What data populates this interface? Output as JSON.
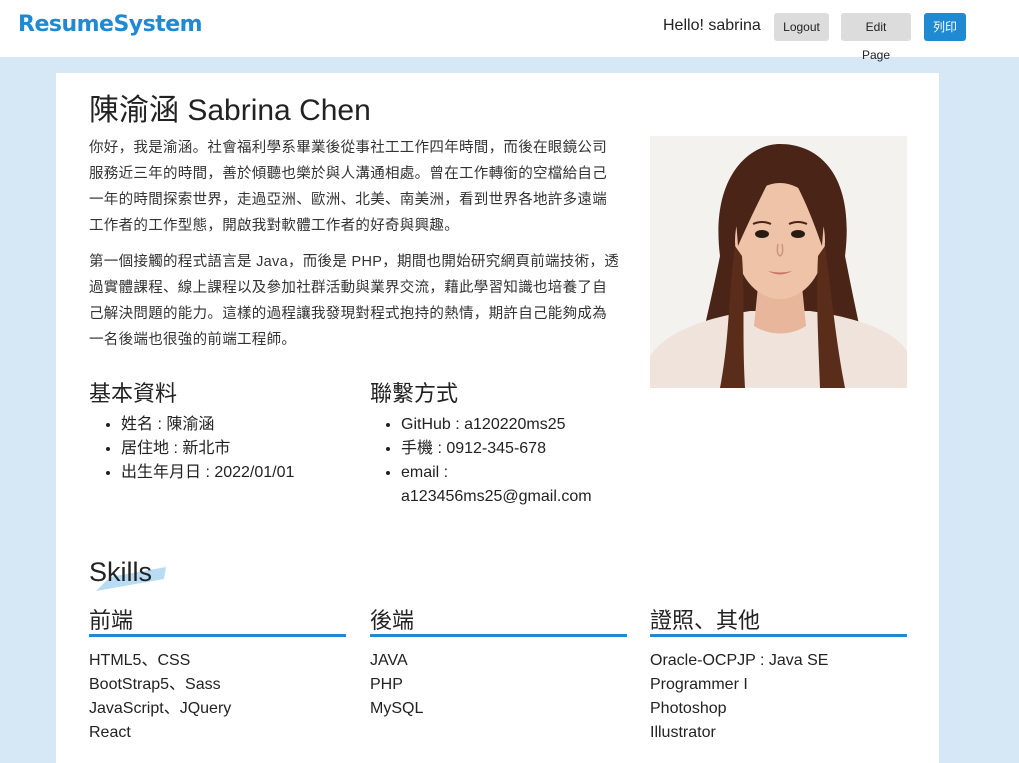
{
  "header": {
    "brand": "ResumeSystem",
    "greeting": "Hello! sabrina",
    "logout_label": "Logout",
    "edit_label": "Edit Page",
    "print_label": "列印"
  },
  "profile": {
    "name": "陳渝涵 Sabrina Chen",
    "intro": [
      "你好，我是渝涵。社會福利學系畢業後從事社工工作四年時間，而後在眼鏡公司服務近三年的時間，善於傾聽也樂於與人溝通相處。曾在工作轉銜的空檔給自己一年的時間探索世界，走過亞洲、歐洲、北美、南美洲，看到世界各地許多遠端工作者的工作型態，開啟我對軟體工作者的好奇與興趣。",
      "第一個接觸的程式語言是 Java，而後是 PHP，期間也開始研究網頁前端技術，透過實體課程、線上課程以及參加社群活動與業界交流，藉此學習知識也培養了自己解決問題的能力。這樣的過程讓我發現對程式抱持的熱情，期許自己能夠成為一名後端也很強的前端工程師。"
    ]
  },
  "basic": {
    "title": "基本資料",
    "items": [
      "姓名 : 陳渝涵",
      "居住地 : 新北市",
      "出生年月日 : 2022/01/01"
    ]
  },
  "contact": {
    "title": "聯繫方式",
    "items": [
      "GitHub : a120220ms25",
      "手機 : 0912-345-678",
      "email : a123456ms25@gmail.com"
    ]
  },
  "skills": {
    "title": "Skills",
    "columns": [
      {
        "title": "前端",
        "items": [
          "HTML5、CSS",
          "BootStrap5、Sass",
          "JavaScript、JQuery",
          "React"
        ]
      },
      {
        "title": "後端",
        "items": [
          "JAVA",
          "PHP",
          "MySQL"
        ]
      },
      {
        "title": "證照、其他",
        "items": [
          "Oracle-OCPJP : Java SE",
          "Programmer I",
          "Photoshop",
          "Illustrator"
        ]
      }
    ]
  },
  "colors": {
    "accent": "#1f8ad2",
    "page_background": "#d6e8f5"
  }
}
